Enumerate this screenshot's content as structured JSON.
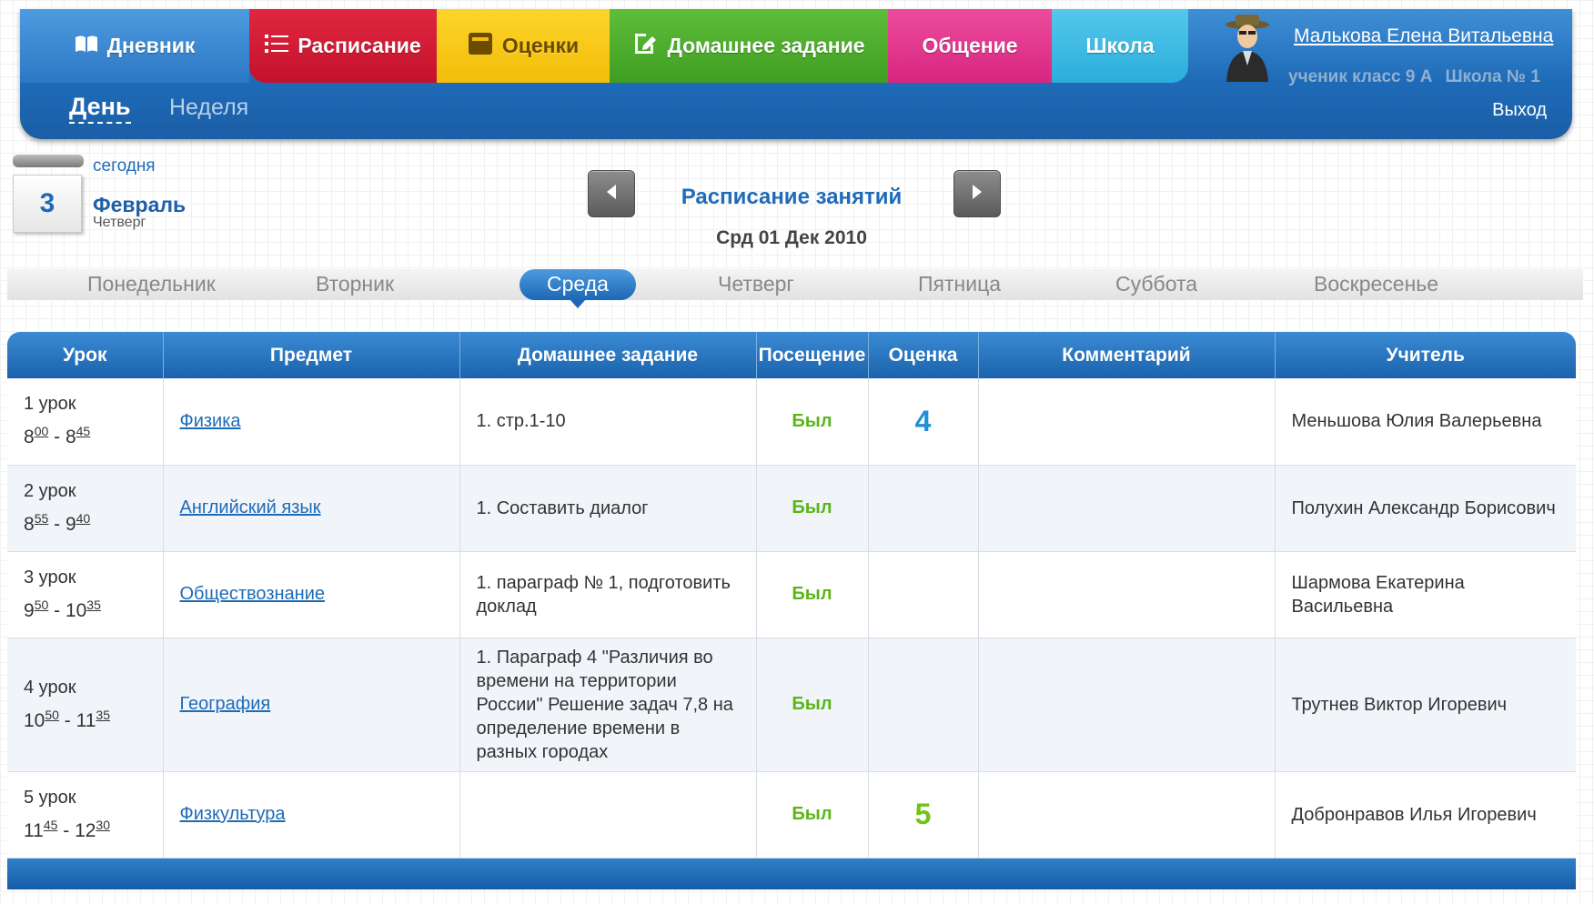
{
  "header": {
    "tabs": [
      {
        "label": "Дневник",
        "icon": "book-icon"
      },
      {
        "label": "Расписание",
        "icon": "list-icon"
      },
      {
        "label": "Оценки",
        "icon": "gradebook-icon"
      },
      {
        "label": "Домашнее задание",
        "icon": "edit-icon"
      },
      {
        "label": "Общение"
      },
      {
        "label": "Школа"
      }
    ],
    "subnav": {
      "day": "День",
      "week": "Неделя"
    },
    "user": {
      "name": "Малькова Елена Витальевна",
      "role_class": "ученик класс 9 А",
      "school": "Школа № 1",
      "logout": "Выход"
    }
  },
  "today": {
    "link": "сегодня",
    "day": "3",
    "month": "Февраль",
    "weekday": "Четверг"
  },
  "schedule": {
    "title": "Расписание занятий",
    "date": "Срд 01 Дек 2010"
  },
  "weekdays": [
    "Понедельник",
    "Вторник",
    "Среда",
    "Четверг",
    "Пятница",
    "Суббота",
    "Воскресенье"
  ],
  "active_weekday": "Среда",
  "table": {
    "columns": [
      "Урок",
      "Предмет",
      "Домашнее задание",
      "Посещение",
      "Оценка",
      "Комментарий",
      "Учитель"
    ],
    "rows": [
      {
        "lesson": "1 урок",
        "start_h": "8",
        "start_m": "00",
        "end_h": "8",
        "end_m": "45",
        "subject": "Физика",
        "homework": "1. стр.1-10",
        "attendance": "Был",
        "grade": "4",
        "comment": "",
        "teacher": "Меньшова Юлия Валерьевна"
      },
      {
        "lesson": "2 урок",
        "start_h": "8",
        "start_m": "55",
        "end_h": "9",
        "end_m": "40",
        "subject": "Английский язык",
        "homework": "1. Составить диалог",
        "attendance": "Был",
        "grade": "",
        "comment": "",
        "teacher": "Полухин Александр Борисович"
      },
      {
        "lesson": "3 урок",
        "start_h": "9",
        "start_m": "50",
        "end_h": "10",
        "end_m": "35",
        "subject": "Обществознание",
        "homework": "1. параграф № 1, подготовить доклад",
        "attendance": "Был",
        "grade": "",
        "comment": "",
        "teacher": "Шармова Екатерина Васильевна"
      },
      {
        "lesson": "4 урок",
        "start_h": "10",
        "start_m": "50",
        "end_h": "11",
        "end_m": "35",
        "subject": "География",
        "homework": "1. Параграф 4 \"Различия во времени на территории России\" Решение задач 7,8 на определение времени в разных городах",
        "attendance": "Был",
        "grade": "",
        "comment": "",
        "teacher": "Трутнев Виктор Игоревич"
      },
      {
        "lesson": "5 урок",
        "start_h": "11",
        "start_m": "45",
        "end_h": "12",
        "end_m": "30",
        "subject": "Физкультура",
        "homework": "",
        "attendance": "Был",
        "grade": "5",
        "comment": "",
        "teacher": "Добронравов Илья Игоревич"
      }
    ]
  },
  "colors": {
    "header_blue": "#1f6bb8",
    "schedule_red": "#c4122c",
    "grades_yellow": "#f3bd0a",
    "homework_green": "#3f9e21",
    "communication_pink": "#d82680",
    "school_cyan": "#29aedc",
    "attendance_green": "#5bb518",
    "grade_4_color": "#1f8fd6",
    "grade_5_color": "#72c21c"
  }
}
